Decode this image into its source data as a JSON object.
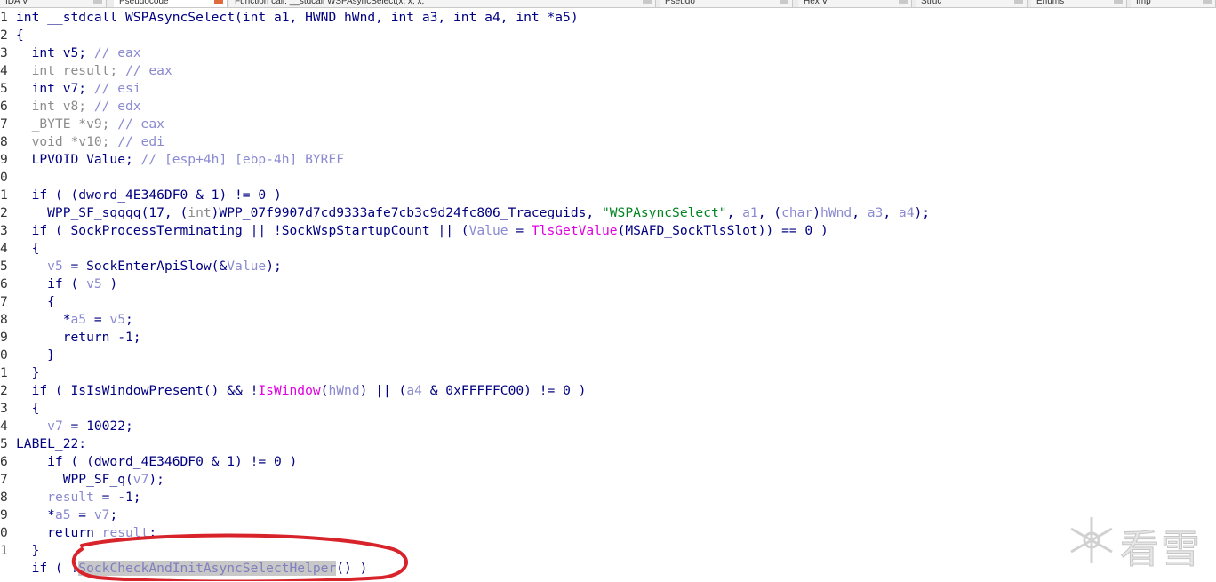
{
  "tabs": [
    {
      "label": "IDA V",
      "active": false
    },
    {
      "label": "Pseudocode",
      "active": true
    },
    {
      "label": "Function call: __stdcall WSPAsyncSelect(x, x, x,",
      "active": false
    },
    {
      "label": "Pseudo",
      "active": false
    },
    {
      "label": "Hex V",
      "active": false
    },
    {
      "label": "Struc",
      "active": false
    },
    {
      "label": "Enums",
      "active": false
    },
    {
      "label": "Imp",
      "active": false
    }
  ],
  "code_lines": [
    {
      "n": "1",
      "segs": [
        [
          "int __stdcall WSPAsyncSelect(int a1, HWND hWnd, int a3, int a4, int *a5)",
          "key"
        ]
      ]
    },
    {
      "n": "2",
      "segs": [
        [
          "{",
          "key"
        ]
      ]
    },
    {
      "n": "3",
      "segs": [
        [
          "  int v5; ",
          "key"
        ],
        [
          "// eax",
          "com"
        ]
      ]
    },
    {
      "n": "4",
      "segs": [
        [
          "  int result; ",
          "gray"
        ],
        [
          "// eax",
          "com"
        ]
      ]
    },
    {
      "n": "5",
      "segs": [
        [
          "  int v7; ",
          "key"
        ],
        [
          "// esi",
          "com"
        ]
      ]
    },
    {
      "n": "6",
      "segs": [
        [
          "  int v8; ",
          "gray"
        ],
        [
          "// edx",
          "com"
        ]
      ]
    },
    {
      "n": "7",
      "segs": [
        [
          "  _BYTE *v9; ",
          "gray"
        ],
        [
          "// eax",
          "com"
        ]
      ]
    },
    {
      "n": "8",
      "segs": [
        [
          "  void *v10; ",
          "gray"
        ],
        [
          "// edi",
          "com"
        ]
      ]
    },
    {
      "n": "9",
      "segs": [
        [
          "  LPVOID Value; ",
          "key"
        ],
        [
          "// [esp+4h] [ebp-4h] BYREF",
          "com"
        ]
      ]
    },
    {
      "n": "0",
      "segs": [
        [
          "",
          "key"
        ]
      ]
    },
    {
      "n": "1",
      "segs": [
        [
          "  if ( (dword_4E346DF0 & 1) != 0 )",
          "key"
        ]
      ]
    },
    {
      "n": "2",
      "segs": [
        [
          "    WPP_SF_sqqqq(17, (",
          "key"
        ],
        [
          "int",
          "gray"
        ],
        [
          ")WPP_07f9907d7cd9333afe7cb3c9d24fc806_Traceguids, ",
          "key"
        ],
        [
          "\"WSPAsyncSelect\"",
          "str"
        ],
        [
          ", ",
          "key"
        ],
        [
          "a1",
          "var"
        ],
        [
          ", (",
          "key"
        ],
        [
          "char",
          "var"
        ],
        [
          ")",
          "key"
        ],
        [
          "hWnd",
          "var"
        ],
        [
          ", ",
          "key"
        ],
        [
          "a3",
          "var"
        ],
        [
          ", ",
          "key"
        ],
        [
          "a4",
          "var"
        ],
        [
          ");",
          "key"
        ]
      ]
    },
    {
      "n": "3",
      "segs": [
        [
          "  if ( SockProcessTerminating || !SockWspStartupCount || (",
          "key"
        ],
        [
          "Value",
          "var"
        ],
        [
          " = ",
          "key"
        ],
        [
          "TlsGetValue",
          "imp"
        ],
        [
          "(MSAFD_SockTlsSlot)) == 0 )",
          "key"
        ]
      ]
    },
    {
      "n": "4",
      "segs": [
        [
          "  {",
          "key"
        ]
      ]
    },
    {
      "n": "5",
      "segs": [
        [
          "    ",
          "key"
        ],
        [
          "v5",
          "var"
        ],
        [
          " = SockEnterApiSlow(&",
          "key"
        ],
        [
          "Value",
          "var"
        ],
        [
          ");",
          "key"
        ]
      ]
    },
    {
      "n": "6",
      "segs": [
        [
          "    if ( ",
          "key"
        ],
        [
          "v5",
          "var"
        ],
        [
          " )",
          "key"
        ]
      ]
    },
    {
      "n": "7",
      "segs": [
        [
          "    {",
          "key"
        ]
      ]
    },
    {
      "n": "8",
      "segs": [
        [
          "      *",
          "key"
        ],
        [
          "a5",
          "var"
        ],
        [
          " = ",
          "key"
        ],
        [
          "v5",
          "var"
        ],
        [
          ";",
          "key"
        ]
      ]
    },
    {
      "n": "9",
      "segs": [
        [
          "      return -1;",
          "key"
        ]
      ]
    },
    {
      "n": "0",
      "segs": [
        [
          "    }",
          "key"
        ]
      ]
    },
    {
      "n": "1",
      "segs": [
        [
          "  }",
          "key"
        ]
      ]
    },
    {
      "n": "2",
      "segs": [
        [
          "  if ( IsIsWindowPresent() && !",
          "key"
        ],
        [
          "IsWindow",
          "imp"
        ],
        [
          "(",
          "key"
        ],
        [
          "hWnd",
          "var"
        ],
        [
          ") || (",
          "key"
        ],
        [
          "a4",
          "var"
        ],
        [
          " & 0xFFFFFC00) != 0 )",
          "key"
        ]
      ]
    },
    {
      "n": "3",
      "segs": [
        [
          "  {",
          "key"
        ]
      ]
    },
    {
      "n": "4",
      "segs": [
        [
          "    ",
          "key"
        ],
        [
          "v7",
          "var"
        ],
        [
          " = 10022;",
          "key"
        ]
      ]
    },
    {
      "n": "5",
      "segs": [
        [
          "LABEL_22:",
          "key"
        ]
      ]
    },
    {
      "n": "6",
      "segs": [
        [
          "    if ( (dword_4E346DF0 & 1) != 0 )",
          "key"
        ]
      ]
    },
    {
      "n": "7",
      "segs": [
        [
          "      WPP_SF_q(",
          "key"
        ],
        [
          "v7",
          "var"
        ],
        [
          ");",
          "key"
        ]
      ]
    },
    {
      "n": "8",
      "segs": [
        [
          "    ",
          "key"
        ],
        [
          "result",
          "var"
        ],
        [
          " = -1;",
          "key"
        ]
      ]
    },
    {
      "n": "9",
      "segs": [
        [
          "    *",
          "key"
        ],
        [
          "a5",
          "var"
        ],
        [
          " = ",
          "key"
        ],
        [
          "v7",
          "var"
        ],
        [
          ";",
          "key"
        ]
      ]
    },
    {
      "n": "0",
      "segs": [
        [
          "    return ",
          "key"
        ],
        [
          "result",
          "var"
        ],
        [
          ";",
          "key"
        ]
      ]
    },
    {
      "n": "1",
      "segs": [
        [
          "  }",
          "key"
        ]
      ]
    },
    {
      "n": "",
      "segs": [
        [
          "  if ( !",
          "key"
        ],
        [
          "SockCheckAndInitAsyncSelectHelper",
          "hl"
        ],
        [
          "() )",
          "key"
        ]
      ]
    }
  ],
  "watermark": {
    "text": "看雪",
    "icon": "snowflake-icon"
  },
  "annotation": {
    "color": "#d8232a",
    "shape": "ellipse"
  }
}
